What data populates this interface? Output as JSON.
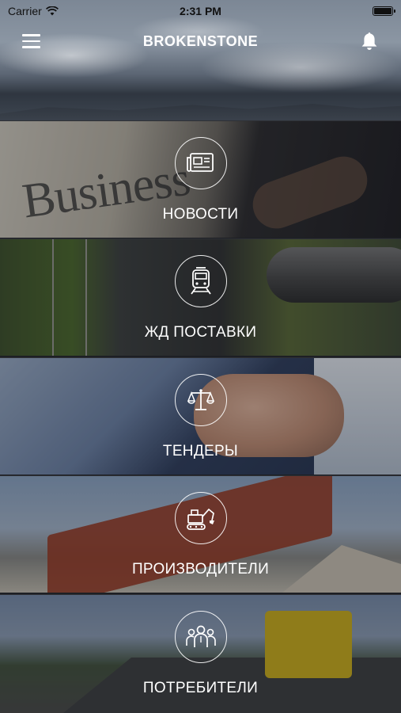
{
  "status_bar": {
    "carrier": "Carrier",
    "time": "2:31 PM",
    "battery_level": 1.0
  },
  "nav": {
    "title": "BROKENSTONE",
    "menu_icon": "hamburger-menu-icon",
    "bell_icon": "bell-icon"
  },
  "menu": {
    "items": [
      {
        "label": "НОВОСТИ",
        "icon": "newspaper-icon"
      },
      {
        "label": "ЖД ПОСТАВКИ",
        "icon": "train-icon"
      },
      {
        "label": "ТЕНДЕРЫ",
        "icon": "scales-icon"
      },
      {
        "label": "ПРОИЗВОДИТЕЛИ",
        "icon": "excavator-icon"
      },
      {
        "label": "ПОТРЕБИТЕЛИ",
        "icon": "people-group-icon"
      }
    ]
  },
  "background_texts": {
    "news_paper": "Business"
  },
  "colors": {
    "text": "#ffffff",
    "overlay": "#14161c"
  }
}
